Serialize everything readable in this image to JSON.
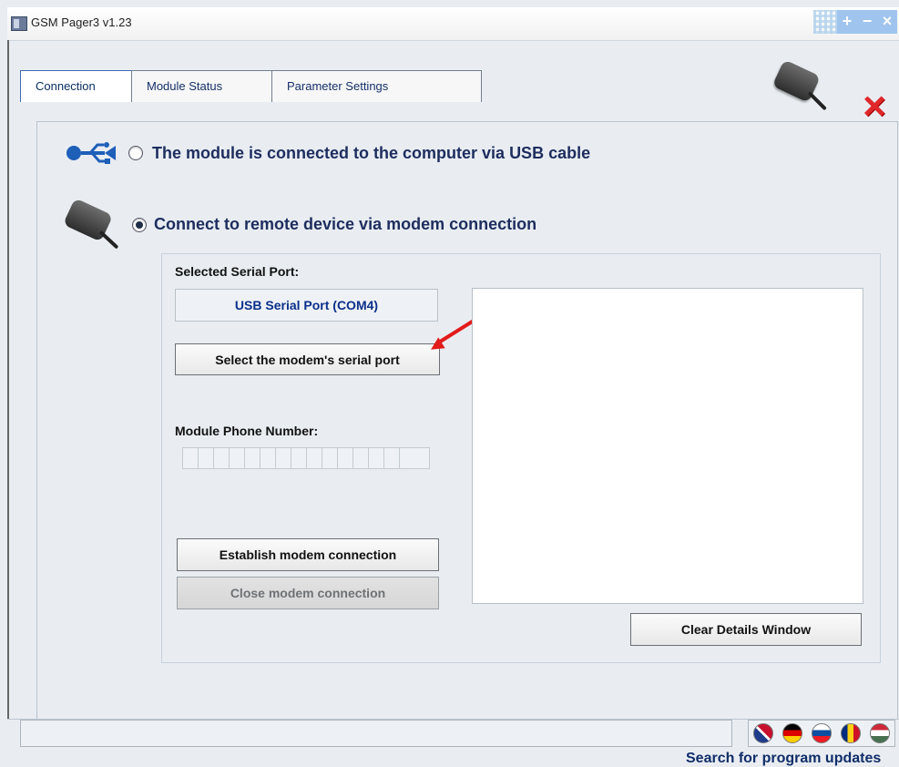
{
  "window": {
    "title": "GSM Pager3 v1.23"
  },
  "tabs": [
    {
      "label": "Connection"
    },
    {
      "label": "Module Status"
    },
    {
      "label": "Parameter Settings"
    }
  ],
  "connection": {
    "usb_label": "The module is connected to the computer via USB cable",
    "remote_label": "Connect to remote device via modem connection",
    "usb_selected": false,
    "remote_selected": true,
    "selected_serial_port_label": "Selected Serial Port:",
    "selected_serial_port_value": "USB Serial Port (COM4)",
    "select_port_button": "Select the modem's serial port",
    "module_phone_number_label": "Module Phone Number:",
    "phone_digits": 15,
    "establish_button": "Establish modem connection",
    "close_button": "Close modem connection",
    "clear_details_button": "Clear Details Window",
    "search_updates_link": "Search for program updates"
  },
  "flags": [
    {
      "name": "uk-flag-icon"
    },
    {
      "name": "germany-flag-icon"
    },
    {
      "name": "slovakia-flag-icon"
    },
    {
      "name": "romania-flag-icon"
    },
    {
      "name": "hungary-flag-icon"
    }
  ],
  "colors": {
    "accent": "#1d2d5e",
    "link": "#102d69",
    "alert_red": "#e21b1b"
  }
}
